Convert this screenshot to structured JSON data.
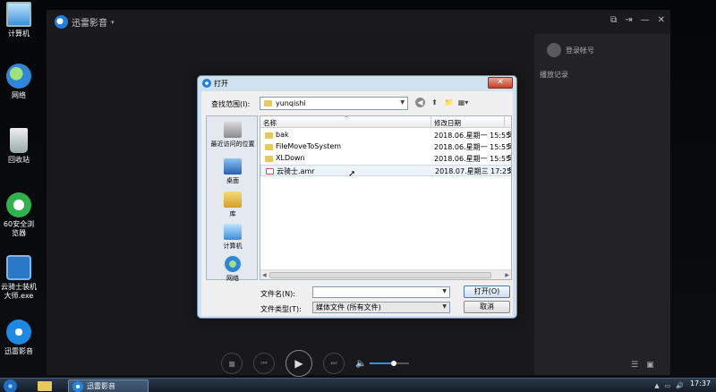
{
  "desktop": {
    "icons": [
      {
        "label": "计算机",
        "icon": "computer-icon"
      },
      {
        "label": "网络",
        "icon": "network-icon"
      },
      {
        "label": "回收站",
        "icon": "recycle-bin-icon"
      },
      {
        "label": "60安全浏览器",
        "icon": "browser-icon"
      },
      {
        "label": "云骑士装机大师.exe",
        "icon": "installer-icon"
      },
      {
        "label": "迅雷影音",
        "icon": "player-icon"
      }
    ]
  },
  "player": {
    "app_name": "迅雷影音",
    "caret": "▾",
    "login_label": "登录帐号",
    "history_title": "播放记录",
    "window_buttons": [
      "⧉",
      "⇥",
      "—",
      "✕"
    ],
    "controls": {
      "stop": "■",
      "prev": "⏮",
      "play": "▶",
      "next": "⏭",
      "volume_icon": "🔈"
    },
    "volume": 0.6,
    "side_icons": [
      "☰",
      "▣"
    ],
    "accent": "#2e8fff"
  },
  "dialog": {
    "title": "打开",
    "close": "✕",
    "look_in_label": "查找范围(I):",
    "look_in_value": "yunqishi",
    "columns": {
      "name": "名称",
      "date": "修改日期",
      "sort_arrow": "^"
    },
    "places": [
      "最近访问的位置",
      "桌面",
      "库",
      "计算机",
      "网络"
    ],
    "files": [
      {
        "name": "bak",
        "date": "2018.06.星期一 15:55",
        "type": "folder",
        "more": "5"
      },
      {
        "name": "FileMoveToSystem",
        "date": "2018.06.星期一 15:55",
        "type": "folder",
        "more": "5"
      },
      {
        "name": "XLDown",
        "date": "2018.06.星期一 15:55",
        "type": "folder",
        "more": "5"
      },
      {
        "name": "云骑士.amr",
        "date": "2018.07.星期三 17:25",
        "type": "audio",
        "more": "5"
      }
    ],
    "filename_label": "文件名(N):",
    "filename_value": "",
    "filetype_label": "文件类型(T):",
    "filetype_value": "媒体文件 (所有文件)",
    "open_button": "打开(O)",
    "cancel_button": "取消"
  },
  "taskbar": {
    "player_item": "迅雷影音",
    "clock": "17:37",
    "tray": [
      "▲",
      "▭",
      "🔊"
    ]
  }
}
